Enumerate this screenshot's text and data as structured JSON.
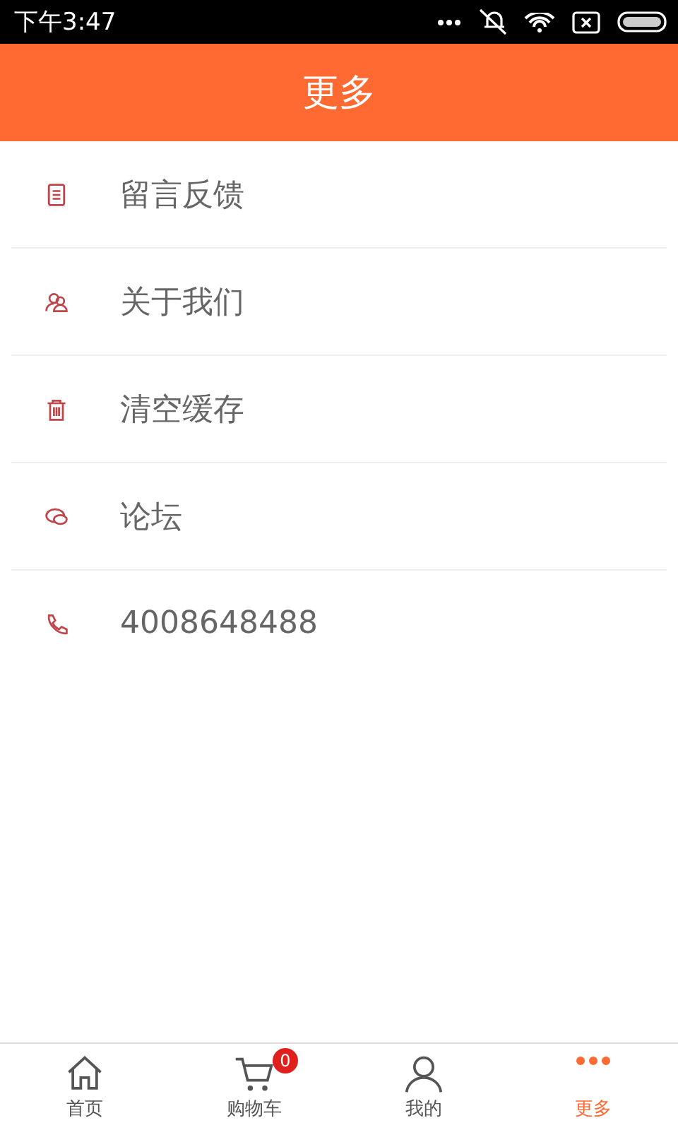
{
  "status_bar": {
    "time": "下午3:47"
  },
  "header": {
    "title": "更多"
  },
  "menu": [
    {
      "kind": "document",
      "label": "留言反馈"
    },
    {
      "kind": "people",
      "label": "关于我们"
    },
    {
      "kind": "trash",
      "label": "清空缓存"
    },
    {
      "kind": "chat",
      "label": "论坛"
    },
    {
      "kind": "phone",
      "label": "4008648488"
    }
  ],
  "tabs": [
    {
      "kind": "home",
      "label": "首页",
      "selected": false
    },
    {
      "kind": "cart",
      "label": "购物车",
      "selected": false,
      "badge": "0"
    },
    {
      "kind": "person",
      "label": "我的",
      "selected": false
    },
    {
      "kind": "more",
      "label": "更多",
      "selected": true
    }
  ]
}
